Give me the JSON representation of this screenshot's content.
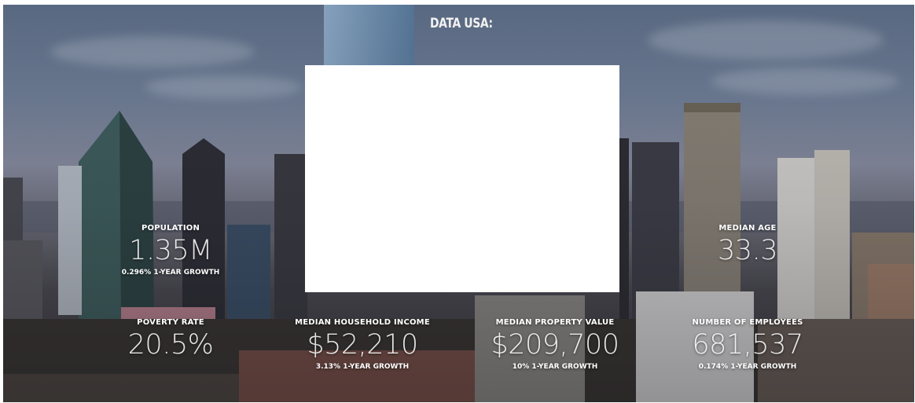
{
  "brand": {
    "logo_text": "DATA USA:"
  },
  "stats": {
    "population": {
      "label": "POPULATION",
      "value": "1.35M",
      "growth": "0.296% 1-YEAR GROWTH"
    },
    "median_age": {
      "label": "MEDIAN AGE",
      "value": "33.3"
    },
    "poverty_rate": {
      "label": "POVERTY RATE",
      "value": "20.5%"
    },
    "median_household_income": {
      "label": "MEDIAN HOUSEHOLD INCOME",
      "value": "$52,210",
      "growth": "3.13% 1-YEAR GROWTH"
    },
    "median_property_value": {
      "label": "MEDIAN PROPERTY VALUE",
      "value": "$209,700",
      "growth": "10% 1-YEAR GROWTH"
    },
    "number_of_employees": {
      "label": "NUMBER OF EMPLOYEES",
      "value": "681,537",
      "growth": "0.174% 1-YEAR GROWTH"
    }
  },
  "colors": {
    "sky_top": "#5c6d86",
    "text": "#ffffff",
    "overlay_box": "#ffffff"
  }
}
